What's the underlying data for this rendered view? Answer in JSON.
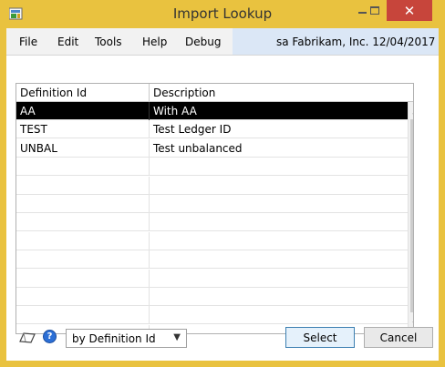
{
  "window": {
    "title": "Import Lookup",
    "close_glyph": "✕"
  },
  "menu": {
    "items": [
      "File",
      "Edit",
      "Tools",
      "Help",
      "Debug"
    ],
    "user_info": "sa  Fabrikam, Inc.  12/04/2017"
  },
  "list": {
    "columns": [
      "Definition Id",
      "Description"
    ],
    "rows": [
      {
        "id": "AA",
        "description": "With AA",
        "selected": true
      },
      {
        "id": "TEST",
        "description": "Test Ledger ID",
        "selected": false
      },
      {
        "id": "UNBAL",
        "description": "Test unbalanced",
        "selected": false
      },
      {
        "id": "",
        "description": "",
        "selected": false
      },
      {
        "id": "",
        "description": "",
        "selected": false
      },
      {
        "id": "",
        "description": "",
        "selected": false
      },
      {
        "id": "",
        "description": "",
        "selected": false
      },
      {
        "id": "",
        "description": "",
        "selected": false
      },
      {
        "id": "",
        "description": "",
        "selected": false
      },
      {
        "id": "",
        "description": "",
        "selected": false
      },
      {
        "id": "",
        "description": "",
        "selected": false
      },
      {
        "id": "",
        "description": "",
        "selected": false
      },
      {
        "id": "",
        "description": "",
        "selected": false
      }
    ]
  },
  "footer": {
    "sort_value": "by Definition Id",
    "select_label": "Select",
    "cancel_label": "Cancel",
    "help_glyph": "?"
  },
  "icons": {
    "app": "app-icon",
    "note": "note-icon",
    "help": "help-icon"
  },
  "colors": {
    "title_bar": "#e9c23f",
    "close_button": "#c7453b",
    "selected_row": "#000000",
    "company_bar": "#dbe7f6"
  }
}
